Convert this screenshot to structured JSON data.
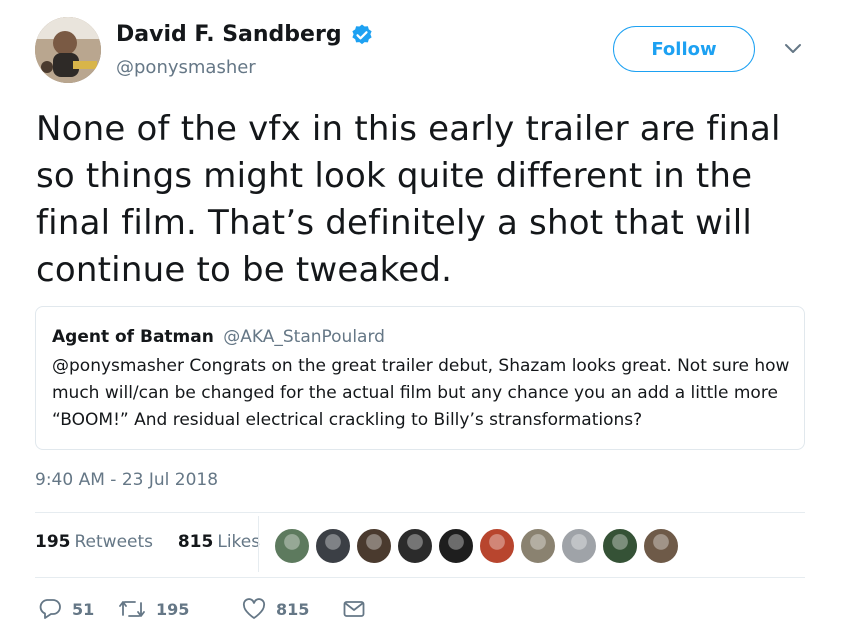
{
  "author": {
    "name": "David F. Sandberg",
    "handle": "@ponysmasher",
    "verified": true
  },
  "header": {
    "follow_label": "Follow"
  },
  "tweet": {
    "text": "None of the vfx in this early trailer are final so things might look quite different in the final film. That’s definitely a shot that will continue to be tweaked."
  },
  "quoted_tweet": {
    "name": "Agent of Batman",
    "handle": "@AKA_StanPoulard",
    "text": "@ponysmasher Congrats on the great trailer debut, Shazam looks great. Not sure how much will/can be changed for the actual film but any chance you an add a little more “BOOM!” And residual electrical crackling to Billy’s stransformations?"
  },
  "timestamp": "9:40 AM - 23 Jul 2018",
  "stats": {
    "retweets_count": "195",
    "retweets_label": "Retweets",
    "likes_count": "815",
    "likes_label": "Likes"
  },
  "liker_avatars": [
    {
      "color": "#5d7a5e"
    },
    {
      "color": "#3b3f45"
    },
    {
      "color": "#4a3a2e"
    },
    {
      "color": "#2b2b2b"
    },
    {
      "color": "#1e1e1e"
    },
    {
      "color": "#b8452e"
    },
    {
      "color": "#8a8270"
    },
    {
      "color": "#9fa3a8"
    },
    {
      "color": "#355236"
    },
    {
      "color": "#6e5a48"
    }
  ],
  "actions": {
    "replies": "51",
    "retweets": "195",
    "likes": "815"
  },
  "colors": {
    "accent": "#1da1f2",
    "text": "#14171a",
    "secondary": "#657786",
    "border": "#e1e8ed"
  },
  "icons": [
    "verified-badge-icon",
    "chevron-down-icon",
    "reply-icon",
    "retweet-icon",
    "heart-icon",
    "envelope-icon"
  ]
}
